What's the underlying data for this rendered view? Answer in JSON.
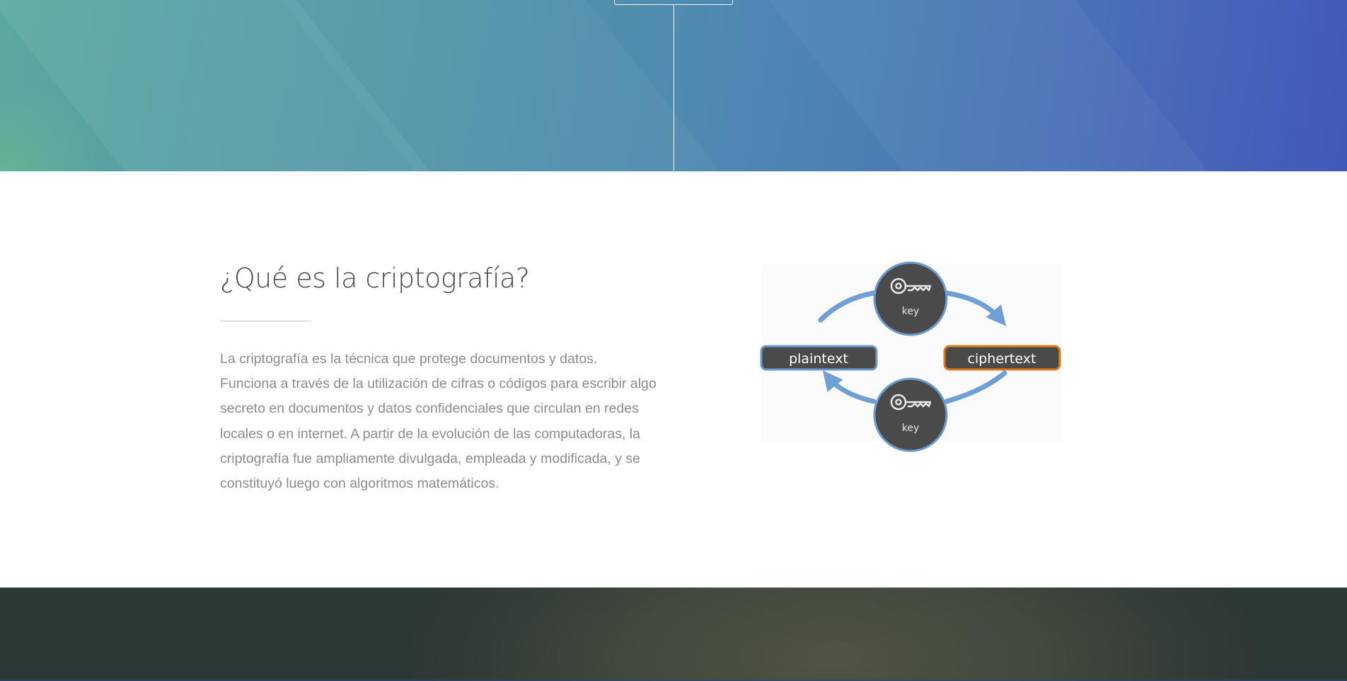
{
  "section": {
    "title": "¿Qué es la criptografía?",
    "body_lines": [
      "La criptografía es la técnica que protege documentos y datos.",
      "Funciona a través de la utilización de cifras o códigos para escribir algo",
      "secreto en documentos y datos confidenciales que circulan en redes",
      "locales o en internet. A partir de la evolución de las computadoras, la",
      "criptografía fue ampliamente divulgada, empleada y modificada, y se",
      "constituyó luego con algoritmos matemáticos."
    ]
  },
  "diagram": {
    "plaintext_label": "plaintext",
    "ciphertext_label": "ciphertext",
    "top_key_label": "key",
    "bottom_key_label": "key",
    "colors": {
      "node_fill": "#4a4a4a",
      "node_stroke": "#6b9bd1",
      "arrow": "#6f9fd4",
      "cipher_stroke": "#e07b1c"
    }
  },
  "colors": {
    "hero_start": "#5aa89f",
    "hero_end": "#4159b8",
    "title_text": "#444a52",
    "body_text": "#8a8d91",
    "footer_dark": "#2c3835"
  }
}
